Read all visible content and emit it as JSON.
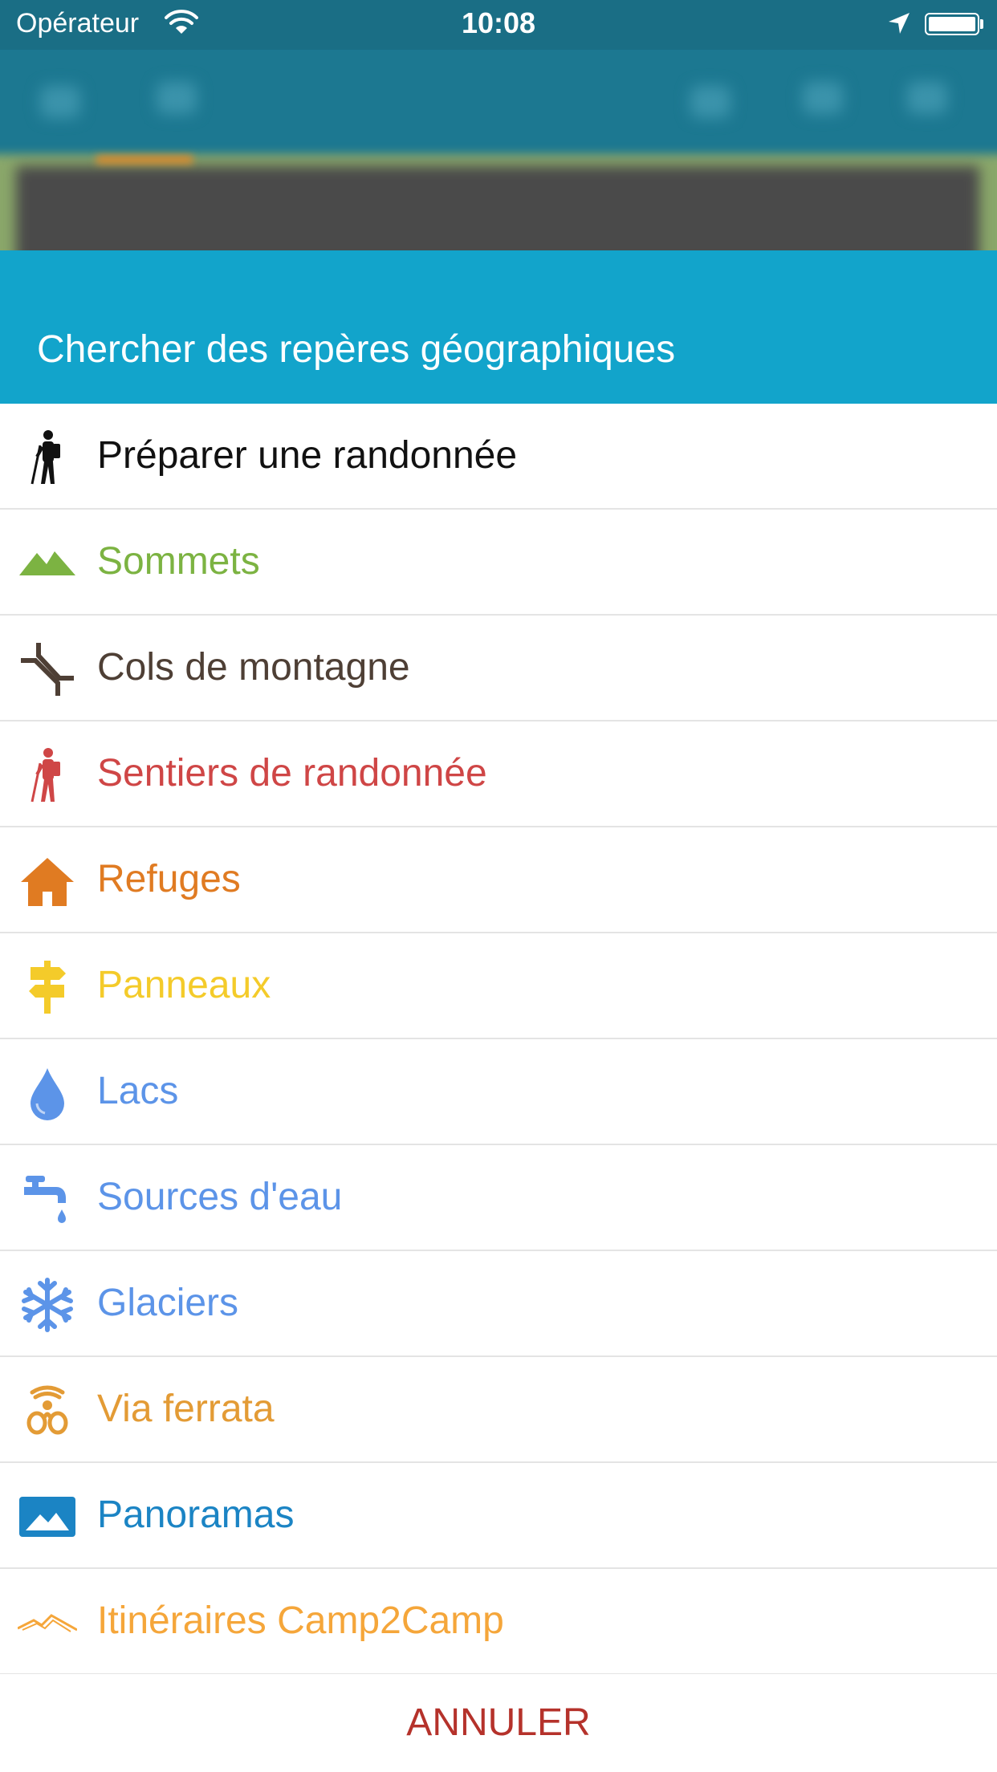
{
  "status_bar": {
    "carrier": "Opérateur",
    "time": "10:08"
  },
  "sheet": {
    "title": "Chercher des repères géographiques"
  },
  "items": [
    {
      "label": "Préparer une randonnée",
      "color": "#111111",
      "icon": "hiker-icon"
    },
    {
      "label": "Sommets",
      "color": "#7cb342",
      "icon": "mountain-icon"
    },
    {
      "label": "Cols de montagne",
      "color": "#4e3f35",
      "icon": "pass-icon"
    },
    {
      "label": "Sentiers de randonnée",
      "color": "#cf4646",
      "icon": "trail-hiker-icon"
    },
    {
      "label": "Refuges",
      "color": "#e07b22",
      "icon": "house-icon"
    },
    {
      "label": "Panneaux",
      "color": "#f4cb2a",
      "icon": "signpost-icon"
    },
    {
      "label": "Lacs",
      "color": "#5c94e8",
      "icon": "water-drop-icon"
    },
    {
      "label": "Sources d'eau",
      "color": "#5c94e8",
      "icon": "tap-icon"
    },
    {
      "label": "Glaciers",
      "color": "#5c94e8",
      "icon": "snowflake-icon"
    },
    {
      "label": "Via ferrata",
      "color": "#e39b35",
      "icon": "harness-icon"
    },
    {
      "label": "Panoramas",
      "color": "#1b84c4",
      "icon": "panorama-icon"
    },
    {
      "label": "Itinéraires Camp2Camp",
      "color": "#f5a63a",
      "icon": "camp2camp-icon"
    }
  ],
  "cancel_label": "ANNULER"
}
